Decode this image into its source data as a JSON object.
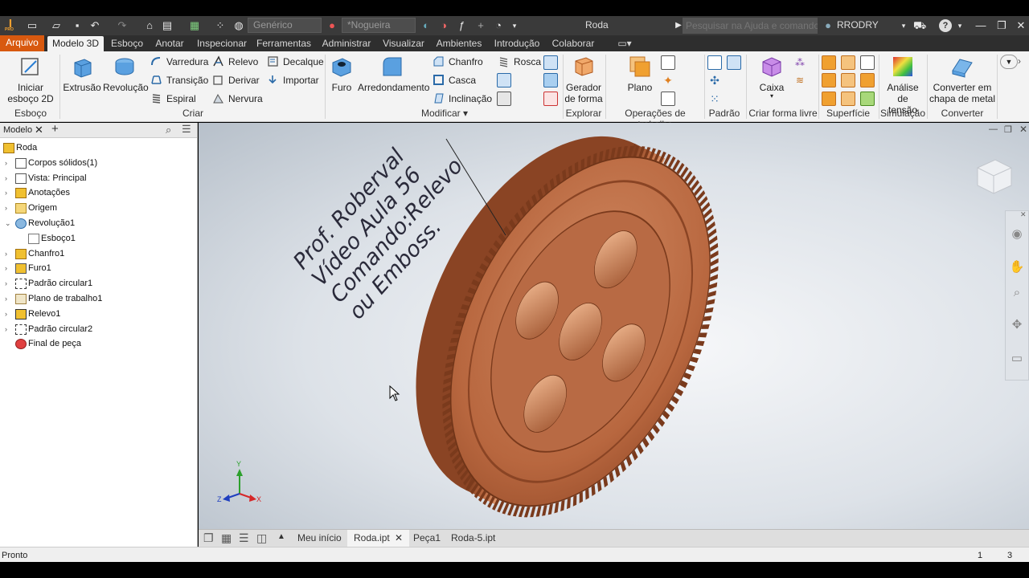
{
  "app": {
    "logo": "I",
    "logo_sub": "PRO",
    "document_title": "Roda",
    "search_placeholder": "Pesquisar na Ajuda e comandos...",
    "user": "RRODRY",
    "material": "Genérico",
    "appearance": "*Nogueira",
    "help": "?"
  },
  "ribbon_tabs": [
    "Arquivo",
    "Modelo 3D",
    "Esboço",
    "Anotar",
    "Inspecionar",
    "Ferramentas",
    "Administrar",
    "Visualizar",
    "Ambientes",
    "Introdução",
    "Colaborar"
  ],
  "ribbon": {
    "esboco": {
      "start_sketch": "Iniciar\nesboço 2D",
      "group": "Esboço"
    },
    "criar": {
      "extrusao": "Extrusão",
      "revolucao": "Revolução",
      "varredura": "Varredura",
      "transicao": "Transição",
      "espiral": "Espiral",
      "relevo": "Relevo",
      "derivar": "Derivar",
      "nervura": "Nervura",
      "decalque": "Decalque",
      "importar": "Importar",
      "group": "Criar"
    },
    "modificar": {
      "furo": "Furo",
      "arredondamento": "Arredondamento",
      "chanfro": "Chanfro",
      "casca": "Casca",
      "inclinacao": "Inclinação",
      "rosca": "Rosca",
      "group": "Modificar"
    },
    "explorar": {
      "gerador": "Gerador\nde forma",
      "group": "Explorar"
    },
    "operacoes": {
      "plano": "Plano",
      "group": "Operações de trabalho"
    },
    "padrao": {
      "group": "Padrão"
    },
    "forma_livre": {
      "caixa": "Caixa",
      "group": "Criar forma livre"
    },
    "superficie": {
      "group": "Superfície"
    },
    "simulacao": {
      "analise": "Análise de\ntensão",
      "group": "Simulação"
    },
    "converter": {
      "chapa": "Converter em\nchapa de metal",
      "group": "Converter"
    }
  },
  "browser": {
    "tab_label": "Modelo",
    "items": [
      {
        "label": "Roda",
        "indent": 0,
        "icon": "part-icon",
        "expand": ""
      },
      {
        "label": "Corpos sólidos(1)",
        "indent": 1,
        "icon": "solid-bodies-icon",
        "expand": "›"
      },
      {
        "label": "Vista: Principal",
        "indent": 1,
        "icon": "view-icon",
        "expand": "›"
      },
      {
        "label": "Anotações",
        "indent": 1,
        "icon": "annotations-icon",
        "expand": "›"
      },
      {
        "label": "Origem",
        "indent": 1,
        "icon": "folder-icon",
        "expand": "›"
      },
      {
        "label": "Revolução1",
        "indent": 1,
        "icon": "revolve-icon",
        "expand": "⌄"
      },
      {
        "label": "Esboço1",
        "indent": 2,
        "icon": "sketch-icon",
        "expand": ""
      },
      {
        "label": "Chanfro1",
        "indent": 1,
        "icon": "chamfer-icon",
        "expand": "›"
      },
      {
        "label": "Furo1",
        "indent": 1,
        "icon": "hole-icon",
        "expand": "›"
      },
      {
        "label": "Padrão circular1",
        "indent": 1,
        "icon": "circular-pattern-icon",
        "expand": "›"
      },
      {
        "label": "Plano de trabalho1",
        "indent": 1,
        "icon": "work-plane-icon",
        "expand": "›"
      },
      {
        "label": "Relevo1",
        "indent": 1,
        "icon": "emboss-icon",
        "expand": "›"
      },
      {
        "label": "Padrão circular2",
        "indent": 1,
        "icon": "circular-pattern-icon",
        "expand": "›"
      },
      {
        "label": "Final de peça",
        "indent": 1,
        "icon": "end-of-part-icon",
        "expand": ""
      }
    ]
  },
  "viewport": {
    "overlay_text": [
      "Prof. Roberval",
      "Vídeo Aula 56",
      "Comando:Relevo",
      "ou Emboss."
    ],
    "axis": {
      "x": "X",
      "y": "Y",
      "z": "Z"
    }
  },
  "doc_tabs": [
    "Meu início",
    "Roda.ipt",
    "Peça1",
    "Roda-5.ipt"
  ],
  "status": {
    "text": "Pronto",
    "count1": "1",
    "count2": "3"
  },
  "colors": {
    "accent": "#d8590f",
    "part": "#b8673f",
    "titlebar": "#3a3a3a"
  }
}
